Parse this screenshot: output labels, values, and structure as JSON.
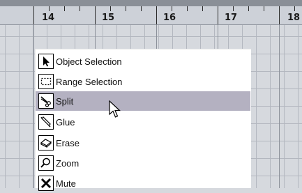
{
  "ruler": {
    "markers": [
      "14",
      "15",
      "16",
      "17",
      "18"
    ]
  },
  "menu": {
    "items": [
      {
        "label": "Object Selection",
        "icon": "arrow-pointer-icon",
        "selected": false
      },
      {
        "label": "Range Selection",
        "icon": "dashed-rectangle-icon",
        "selected": false
      },
      {
        "label": "Split",
        "icon": "scissors-icon",
        "selected": true
      },
      {
        "label": "Glue",
        "icon": "glue-tube-icon",
        "selected": false
      },
      {
        "label": "Erase",
        "icon": "eraser-icon",
        "selected": false
      },
      {
        "label": "Zoom",
        "icon": "magnifier-icon",
        "selected": false
      },
      {
        "label": "Mute",
        "icon": "x-mute-icon",
        "selected": false
      }
    ]
  },
  "colors": {
    "selected_highlight": "#b4b1c1",
    "grid_background": "#d6d9de",
    "ruler_background": "#cdd1d8"
  }
}
